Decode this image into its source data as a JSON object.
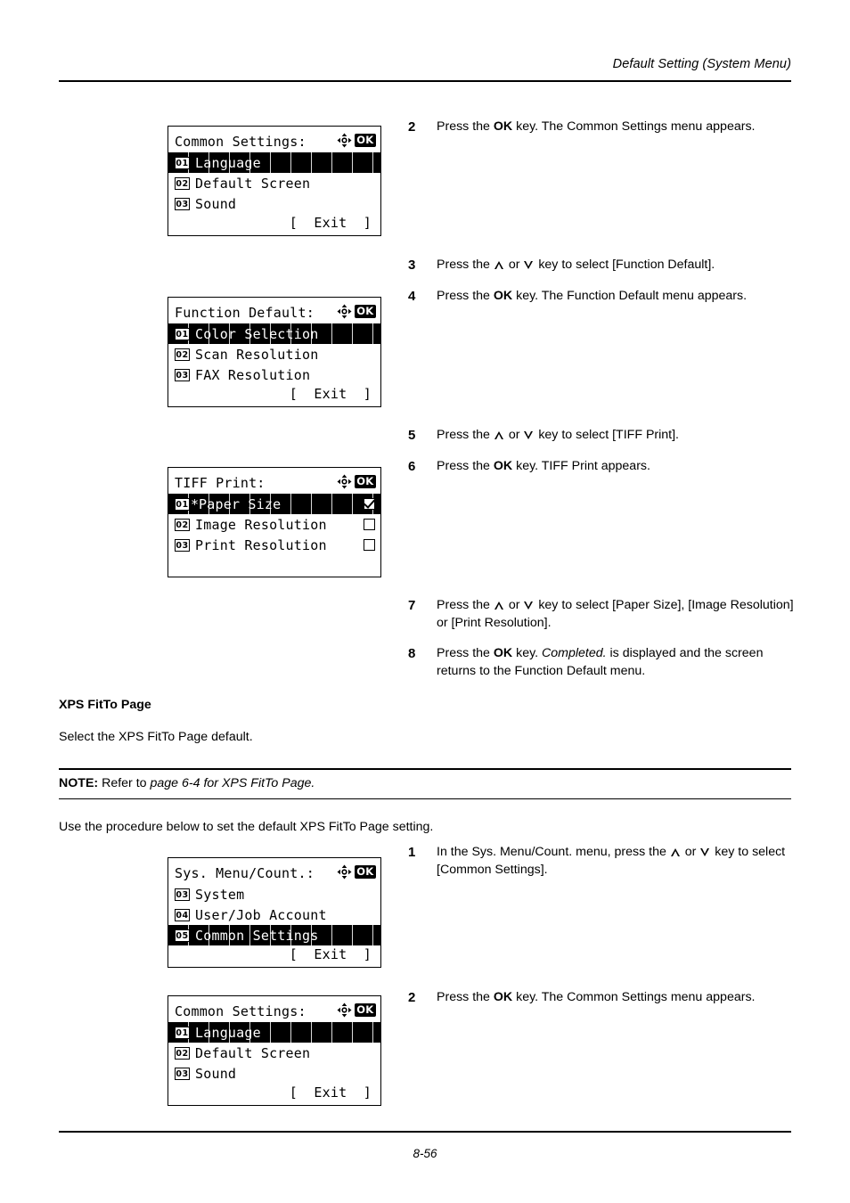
{
  "header": {
    "title": "Default Setting (System Menu)"
  },
  "footer": {
    "page_number": "8-56"
  },
  "panels": {
    "common_settings_1": {
      "title": "Common Settings:",
      "dpad_icon": "four-way-arrow-icon",
      "ok_badge": "OK",
      "rows": [
        {
          "num": "01",
          "label": "Language",
          "selected": true
        },
        {
          "num": "02",
          "label": "Default Screen",
          "selected": false
        },
        {
          "num": "03",
          "label": "Sound",
          "selected": false
        }
      ],
      "exit_label": "[  Exit  ]"
    },
    "function_default": {
      "title": "Function Default:",
      "dpad_icon": "four-way-arrow-icon",
      "ok_badge": "OK",
      "rows": [
        {
          "num": "01",
          "label": "Color Selection",
          "selected": true
        },
        {
          "num": "02",
          "label": "Scan Resolution",
          "selected": false
        },
        {
          "num": "03",
          "label": "FAX Resolution",
          "selected": false
        }
      ],
      "exit_label": "[  Exit  ]"
    },
    "tiff_print": {
      "title": "TIFF Print:",
      "dpad_icon": "four-way-arrow-icon",
      "ok_badge": "OK",
      "rows": [
        {
          "num": "01",
          "label": "Paper Size",
          "star": "*",
          "selected": true,
          "checked": true
        },
        {
          "num": "02",
          "label": "Image Resolution",
          "star": "",
          "selected": false,
          "checked": false
        },
        {
          "num": "03",
          "label": "Print Resolution",
          "star": "",
          "selected": false,
          "checked": false
        }
      ],
      "exit_label": ""
    },
    "sys_menu_count": {
      "title": "Sys. Menu/Count.:",
      "dpad_icon": "four-way-arrow-icon",
      "ok_badge": "OK",
      "rows": [
        {
          "num": "03",
          "label": "System",
          "selected": false
        },
        {
          "num": "04",
          "label": "User/Job Account",
          "selected": false
        },
        {
          "num": "05",
          "label": "Common Settings",
          "selected": true
        }
      ],
      "exit_label": "[  Exit  ]"
    },
    "common_settings_2": {
      "title": "Common Settings:",
      "dpad_icon": "four-way-arrow-icon",
      "ok_badge": "OK",
      "rows": [
        {
          "num": "01",
          "label": "Language",
          "selected": true
        },
        {
          "num": "02",
          "label": "Default Screen",
          "selected": false
        },
        {
          "num": "03",
          "label": "Sound",
          "selected": false
        }
      ],
      "exit_label": "[  Exit  ]"
    }
  },
  "steps": {
    "s2a": {
      "num": "2",
      "pre": "Press the ",
      "bold": "OK",
      "post": " key. The Common Settings menu appears."
    },
    "s3": {
      "num": "3",
      "pre": "Press the ",
      "mid": " or ",
      "post": " key to select [Function Default]."
    },
    "s4": {
      "num": "4",
      "pre": "Press the ",
      "bold": "OK",
      "post": " key. The Function Default menu appears."
    },
    "s5": {
      "num": "5",
      "pre": "Press the ",
      "mid": " or ",
      "post": " key to select [TIFF Print]."
    },
    "s6": {
      "num": "6",
      "pre": "Press the ",
      "bold": "OK",
      "post": " key. TIFF Print appears."
    },
    "s7": {
      "num": "7",
      "pre": "Press the ",
      "mid": " or ",
      "post": " key to select [Paper Size], [Image Resolution] or [Print Resolution]."
    },
    "s8": {
      "num": "8",
      "pre": "Press the ",
      "bold": "OK",
      "mid": " key. ",
      "italic": "Completed.",
      "post": " is displayed and the screen returns to the Function Default menu."
    },
    "s1b": {
      "num": "1",
      "pre": "In the Sys. Menu/Count. menu, press the ",
      "mid": " or ",
      "post": " key to select [Common Settings]."
    },
    "s2b": {
      "num": "2",
      "pre": "Press the ",
      "bold": "OK",
      "post": " key. The Common Settings menu appears."
    }
  },
  "section": {
    "heading": "XPS FitTo Page",
    "intro": "Select the XPS FitTo Page default.",
    "note_label": "NOTE:",
    "note_pre": " Refer to ",
    "note_italic": "page 6-4 for XPS FitTo Page.",
    "procedure": "Use the procedure below to set the default XPS FitTo Page setting."
  }
}
